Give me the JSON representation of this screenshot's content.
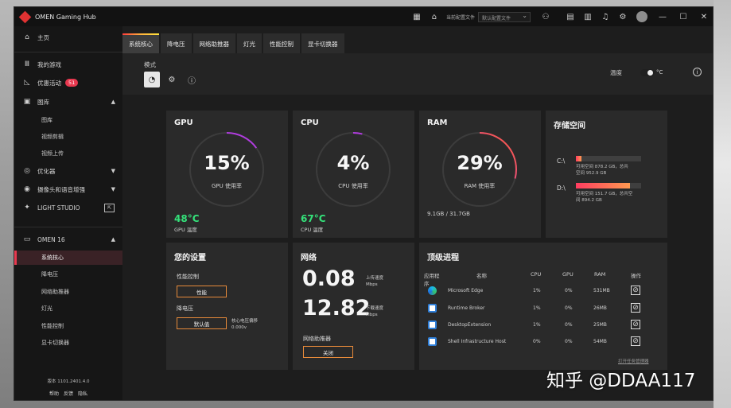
{
  "window": {
    "title": "OMEN Gaming Hub"
  },
  "titlebar": {
    "config_label": "当前配置文件",
    "config_select": "默认配置文件",
    "icons": [
      "library-icon",
      "home-icon",
      "controller-icon",
      "monitor-icon",
      "message-icon",
      "bell-icon",
      "gear-icon",
      "avatar"
    ],
    "win_controls": [
      "—",
      "☐",
      "✕"
    ]
  },
  "sidebar": {
    "home": "主页",
    "my_games": "我的游戏",
    "offers": "优惠活动",
    "offers_badge": "51",
    "gallery": "图库",
    "gallery_items": [
      "图库",
      "视频剪辑",
      "视频上传"
    ],
    "optimizer": "优化器",
    "camera": "摄像头和语音增强",
    "light_studio": "LIGHT STUDIO",
    "device": "OMEN 16",
    "device_items": [
      "系统核心",
      "降电压",
      "网络助推器",
      "灯光",
      "性能控制",
      "显卡切换器"
    ],
    "version": "版本 1101.2401.4.0",
    "footer": [
      "帮助",
      "反馈",
      "隐私"
    ]
  },
  "tabs": [
    "系统核心",
    "降电压",
    "网络助推器",
    "灯光",
    "性能控制",
    "显卡切换器"
  ],
  "mode": {
    "label": "模式",
    "temp_label": "温度",
    "unit": "°C"
  },
  "gpu": {
    "title": "GPU",
    "value": "15%",
    "sub": "GPU 使用率",
    "temp": "48°C",
    "temp_label": "GPU 温度",
    "percent": 15
  },
  "cpu": {
    "title": "CPU",
    "value": "4%",
    "sub": "CPU 使用率",
    "temp": "67°C",
    "temp_label": "CPU 温度",
    "percent": 4
  },
  "ram": {
    "title": "RAM",
    "value": "29%",
    "sub": "RAM 使用率",
    "usage": "9.1GB / 31.7GB",
    "percent": 29
  },
  "storage": {
    "title": "存储空间",
    "drives": [
      {
        "letter": "C:\\",
        "line1": "可用空间 878.2 GB，总共",
        "line2": "空间 952.9 GB",
        "fraction": 0.08
      },
      {
        "letter": "D:\\",
        "line1": "可用空间 151.7 GB，总共空",
        "line2": "间 894.2 GB",
        "fraction": 0.83
      }
    ]
  },
  "settings": {
    "title": "您的设置",
    "perf_label": "性能控制",
    "perf_btn": "性能",
    "uv_label": "降电压",
    "uv_btn": "默认值",
    "uv_note1": "核心电压偏移",
    "uv_note2": "0.000v"
  },
  "network": {
    "title": "网络",
    "upload": "0.08",
    "upload_label1": "上传速度",
    "upload_label2": "Mbps",
    "download": "12.82",
    "download_label1": "下载速度",
    "download_label2": "Mbps",
    "booster_label": "网络助推器",
    "booster_btn": "关闭"
  },
  "processes": {
    "title": "顶级进程",
    "headers": {
      "app": "应用程序",
      "name": "名称",
      "cpu": "CPU",
      "gpu": "GPU",
      "ram": "RAM",
      "action": "操作"
    },
    "rows": [
      {
        "name": "Microsoft Edge",
        "cpu": "1%",
        "gpu": "0%",
        "ram": "531MB",
        "icon": "edge"
      },
      {
        "name": "Runtime Broker",
        "cpu": "1%",
        "gpu": "0%",
        "ram": "26MB",
        "icon": "app"
      },
      {
        "name": "DesktopExtension",
        "cpu": "1%",
        "gpu": "0%",
        "ram": "25MB",
        "icon": "app"
      },
      {
        "name": "Shell Infrastructure Host",
        "cpu": "0%",
        "gpu": "0%",
        "ram": "54MB",
        "icon": "app"
      }
    ],
    "link": "打开任务管理器"
  },
  "watermark": "知乎 @DDAA117"
}
